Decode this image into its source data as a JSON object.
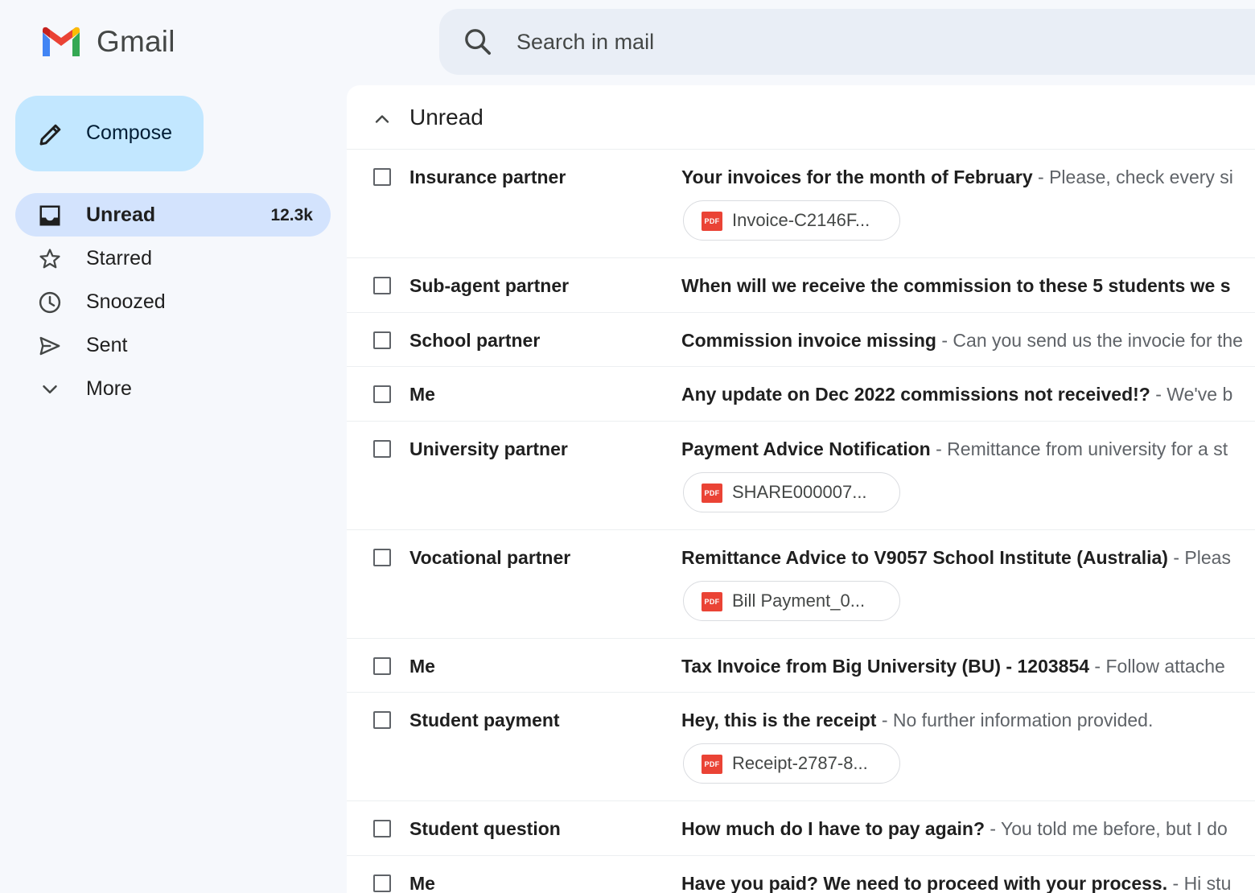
{
  "app": {
    "title": "Gmail"
  },
  "search": {
    "placeholder": "Search in mail"
  },
  "compose": {
    "label": "Compose"
  },
  "nav": {
    "items": [
      {
        "label": "Unread",
        "count": "12.3k",
        "icon": "inbox-icon",
        "active": true
      },
      {
        "label": "Starred",
        "count": "",
        "icon": "star-icon"
      },
      {
        "label": "Snoozed",
        "count": "",
        "icon": "clock-icon"
      },
      {
        "label": "Sent",
        "count": "",
        "icon": "send-icon"
      },
      {
        "label": "More",
        "count": "",
        "icon": "chevron-down-icon"
      }
    ]
  },
  "section": {
    "title": "Unread"
  },
  "emails": [
    {
      "sender": "Insurance partner",
      "subject": "Your invoices for the month of February",
      "snippet": "Please, check every si",
      "attachment": "Invoice-C2146F..."
    },
    {
      "sender": "Sub-agent partner",
      "subject": "When will we receive the commission to these 5 students we s",
      "snippet": "",
      "attachment": ""
    },
    {
      "sender": "School partner",
      "subject": "Commission invoice missing",
      "snippet": "Can you send us the invocie for the",
      "attachment": ""
    },
    {
      "sender": "Me",
      "subject": "Any update on Dec 2022 commissions not received!?",
      "snippet": "We've b",
      "attachment": ""
    },
    {
      "sender": "University partner",
      "subject": "Payment Advice Notification",
      "snippet": "Remittance from university for a st",
      "attachment": "SHARE000007..."
    },
    {
      "sender": "Vocational partner",
      "subject": "Remittance Advice to V9057 School Institute (Australia)",
      "snippet": "Pleas",
      "attachment": "Bill Payment_0..."
    },
    {
      "sender": "Me",
      "subject": "Tax Invoice from Big University (BU) - 1203854",
      "snippet": "Follow attache",
      "attachment": ""
    },
    {
      "sender": "Student payment",
      "subject": "Hey, this is the receipt",
      "snippet": "No further information provided.",
      "attachment": "Receipt-2787-8..."
    },
    {
      "sender": "Student question",
      "subject": "How much do I have to pay again?",
      "snippet": "You told me before, but I do",
      "attachment": ""
    },
    {
      "sender": "Me",
      "subject": "Have you paid? We need to proceed with your process.",
      "snippet": "Hi stu",
      "attachment": ""
    }
  ],
  "strings": {
    "separator": " - ",
    "pdf_badge": "PDF"
  },
  "colors": {
    "accent": "#c2e7ff",
    "active_nav": "#d3e3fd",
    "pdf_red": "#ea4335",
    "background": "#f6f8fc"
  }
}
